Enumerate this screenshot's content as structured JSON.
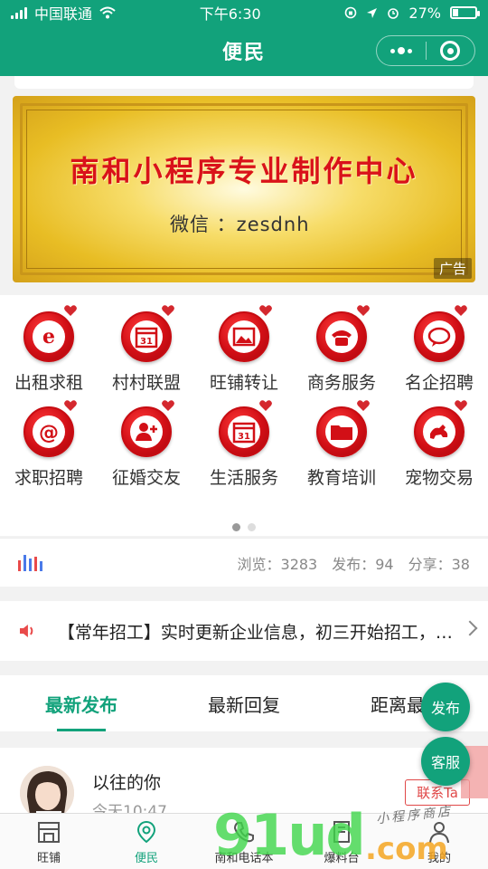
{
  "status": {
    "carrier": "中国联通",
    "time": "下午6:30",
    "battery": "27%",
    "battery_level": 0.27
  },
  "header": {
    "title": "便民"
  },
  "banner": {
    "headline": "南和小程序专业制作中心",
    "wechat": "微信 ：zesdnh",
    "ad_tag": "广告"
  },
  "categories": [
    {
      "label": "出租求租",
      "icon": "ie-icon"
    },
    {
      "label": "村村联盟",
      "icon": "calendar-icon"
    },
    {
      "label": "旺铺转让",
      "icon": "picture-icon"
    },
    {
      "label": "商务服务",
      "icon": "telephone-icon"
    },
    {
      "label": "名企招聘",
      "icon": "chat-icon"
    },
    {
      "label": "求职招聘",
      "icon": "at-icon"
    },
    {
      "label": "征婚交友",
      "icon": "add-user-icon"
    },
    {
      "label": "生活服务",
      "icon": "calendar-icon"
    },
    {
      "label": "教育培训",
      "icon": "folder-icon"
    },
    {
      "label": "宠物交易",
      "icon": "dog-icon"
    }
  ],
  "stats": {
    "views": "浏览：3283",
    "posts": "发布：94",
    "shares": "分享：38"
  },
  "notice": {
    "text": "【常年招工】实时更新企业信息，初三开始招工，…"
  },
  "tabs": [
    {
      "label": "最新发布"
    },
    {
      "label": "最新回复"
    },
    {
      "label": "距离最近"
    }
  ],
  "post": {
    "name": "以往的你",
    "time": "今天10:47",
    "contact": "联系Ta"
  },
  "fab": {
    "publish": "发布",
    "service": "客服"
  },
  "tabbar": [
    {
      "label": "旺铺"
    },
    {
      "label": "便民"
    },
    {
      "label": "南和电话本"
    },
    {
      "label": "爆料台"
    },
    {
      "label": "我的"
    }
  ],
  "watermark": {
    "main": "91ud",
    "domain": ".com",
    "note": "小程序商店"
  },
  "colors": {
    "brand": "#12a27b",
    "accent_red": "#d20f16"
  }
}
